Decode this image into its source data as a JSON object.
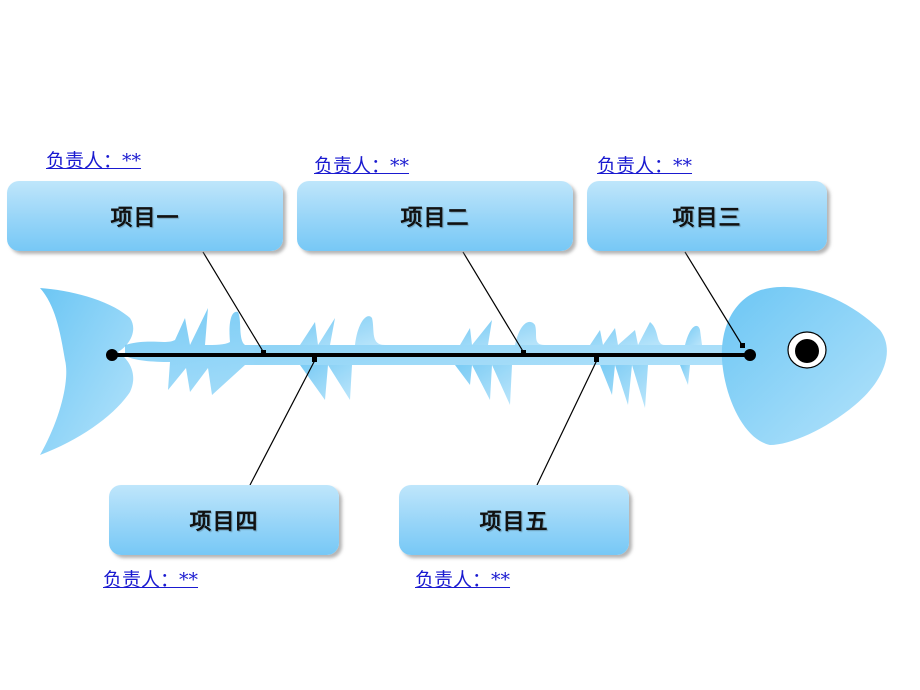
{
  "diagram": {
    "type": "fishbone",
    "items": [
      {
        "label": "项目一",
        "owner": "负责人：**",
        "position": "top"
      },
      {
        "label": "项目二",
        "owner": "负责人：**",
        "position": "top"
      },
      {
        "label": "项目三",
        "owner": "负责人：**",
        "position": "top"
      },
      {
        "label": "项目四",
        "owner": "负责人：**",
        "position": "bottom"
      },
      {
        "label": "项目五",
        "owner": "负责人：**",
        "position": "bottom"
      }
    ],
    "colors": {
      "fish": "#8fd3f7",
      "box": "#9ad6f8",
      "owner_text": "#1a1ad0",
      "spine": "#000000"
    }
  }
}
